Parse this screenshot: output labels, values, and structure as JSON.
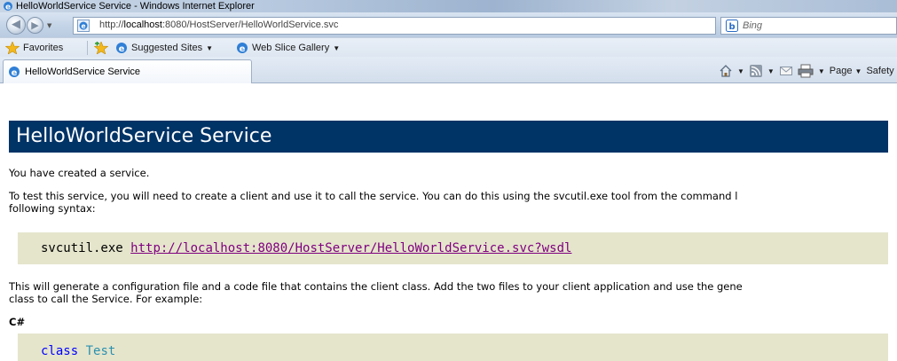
{
  "window": {
    "title": "HelloWorldService Service - Windows Internet Explorer"
  },
  "address_bar": {
    "url_prefix": "http://",
    "url_host": "localhost",
    "url_rest": ":8080/HostServer/HelloWorldService.svc",
    "search_placeholder": "Bing"
  },
  "favorites_bar": {
    "favorites_label": "Favorites",
    "suggested_sites_label": "Suggested Sites",
    "web_slice_label": "Web Slice Gallery"
  },
  "tabs": [
    {
      "label": "HelloWorldService Service"
    }
  ],
  "command_bar": {
    "page_label": "Page",
    "safety_label": "Safety"
  },
  "page": {
    "heading": "HelloWorldService Service",
    "intro": "You have created a service.",
    "test_line1": "To test this service, you will need to create a client and use it to call the service. You can do this using the svcutil.exe tool from the command l",
    "test_line2": "following syntax:",
    "svcutil_cmd": "svcutil.exe",
    "wsdl_link": "http://localhost:8080/HostServer/HelloWorldService.svc?wsdl",
    "generate_line1": "This will generate a configuration file and a code file that contains the client class. Add the two files to your client application and use the gene",
    "generate_line2": "class to call the Service. For example:",
    "lang_label": "C#",
    "code_keyword": "class",
    "code_classname": "Test"
  },
  "colors": {
    "heading_bg": "#003366",
    "code_bg": "#e5e5cc",
    "link": "#800080",
    "keyword": "#0000ff",
    "type_name": "#2b91af"
  }
}
